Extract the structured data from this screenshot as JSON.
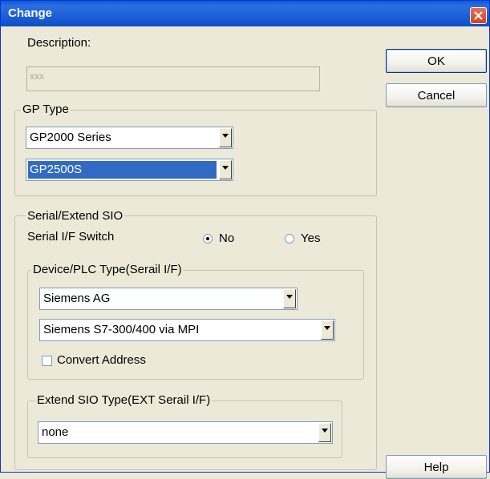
{
  "window": {
    "title": "Change"
  },
  "description": {
    "label": "Description:",
    "value": "xxx"
  },
  "buttons": {
    "ok": "OK",
    "cancel": "Cancel",
    "help": "Help"
  },
  "gp_type": {
    "legend": "GP Type",
    "series": "GP2000 Series",
    "model": "GP2500S"
  },
  "serial": {
    "legend": "Serial/Extend SIO",
    "switch_label": "Serial I/F Switch",
    "radio_no": "No",
    "radio_yes": "Yes",
    "selected": "No",
    "device": {
      "legend": "Device/PLC Type(Serail I/F)",
      "maker": "Siemens AG",
      "model": "Siemens S7-300/400 via MPI",
      "convert_label": "Convert Address",
      "convert_checked": false
    },
    "ext": {
      "legend": "Extend SIO Type(EXT Serail I/F)",
      "value": "none"
    }
  }
}
